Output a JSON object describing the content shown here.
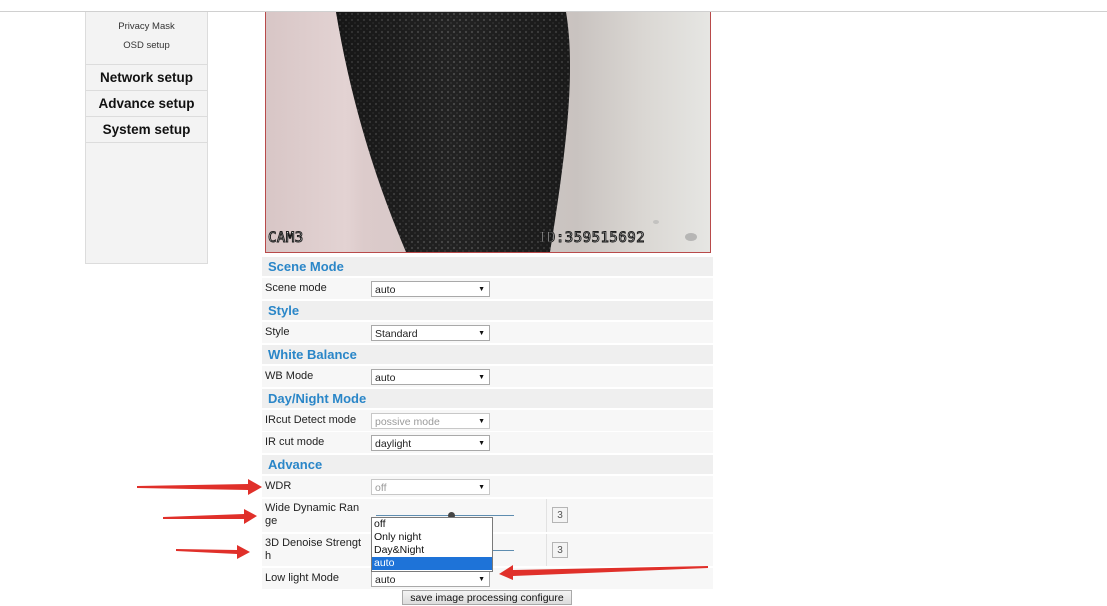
{
  "sidebar": {
    "sub_items": [
      "Privacy Mask",
      "OSD setup"
    ],
    "sections": [
      "Network setup",
      "Advance setup",
      "System setup"
    ]
  },
  "video": {
    "osd_left": "CAM3",
    "osd_right": "ID:359515692"
  },
  "sections": {
    "scene": {
      "title": "Scene Mode",
      "label": "Scene mode",
      "value": "auto"
    },
    "style": {
      "title": "Style",
      "label": "Style",
      "value": "Standard"
    },
    "wb": {
      "title": "White Balance",
      "label": "WB Mode",
      "value": "auto"
    },
    "daynight": {
      "title": "Day/Night Mode",
      "ircut_detect_label": "IRcut Detect mode",
      "ircut_detect_value": "possive mode",
      "ircut_mode_label": "IR cut mode",
      "ircut_mode_value": "daylight"
    },
    "advance": {
      "title": "Advance",
      "wdr_label": "WDR",
      "wdr_value": "off",
      "wide_range_label_1": "Wide Dynamic Ran",
      "wide_range_label_2": "ge",
      "wide_range_value": "3",
      "denoise_label_1": "3D Denoise Strengt",
      "denoise_label_2": "h",
      "denoise_value": "3",
      "lowlight_label": "Low light Mode",
      "lowlight_value": "auto"
    }
  },
  "dropdown": {
    "options": [
      "off",
      "Only night",
      "Day&Night",
      "auto"
    ],
    "selected": "auto"
  },
  "wide_range_level_fraction": 0.55,
  "save_label": "save image processing configure",
  "colors": {
    "section_title": "#2a86c8",
    "arrow": "#e0302a",
    "selected": "#1e73d8"
  }
}
